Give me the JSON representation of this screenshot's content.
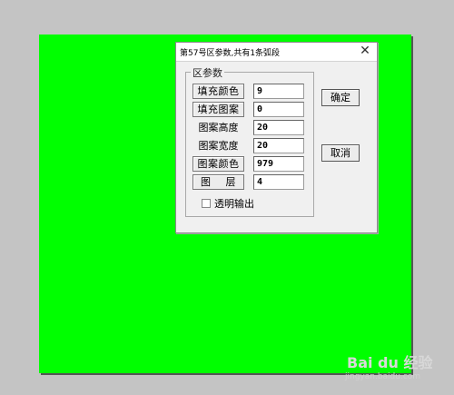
{
  "dialog": {
    "title": "第57号区参数,共有1条弧段",
    "close_glyph": "✕"
  },
  "group": {
    "label": "区参数"
  },
  "rows": [
    {
      "label": "填充颜色",
      "value": "9",
      "is_button": true
    },
    {
      "label": "填充图案",
      "value": "0",
      "is_button": true
    },
    {
      "label": "图案高度",
      "value": "20",
      "is_button": false
    },
    {
      "label": "图案宽度",
      "value": "20",
      "is_button": false
    },
    {
      "label": "图案颜色",
      "value": "979",
      "is_button": true
    },
    {
      "label": "图    层",
      "value": "4",
      "is_button": true
    }
  ],
  "buttons": {
    "ok": "确定",
    "cancel": "取消"
  },
  "transparent_output": {
    "label": "透明输出",
    "checked": false
  },
  "watermark": {
    "logo": "Bai du 经验",
    "url": "jingyan.baidu.com"
  },
  "colors": {
    "canvas": "#00ff00",
    "dialog_bg": "#f0f0f0",
    "desktop": "#c4c4c4"
  }
}
